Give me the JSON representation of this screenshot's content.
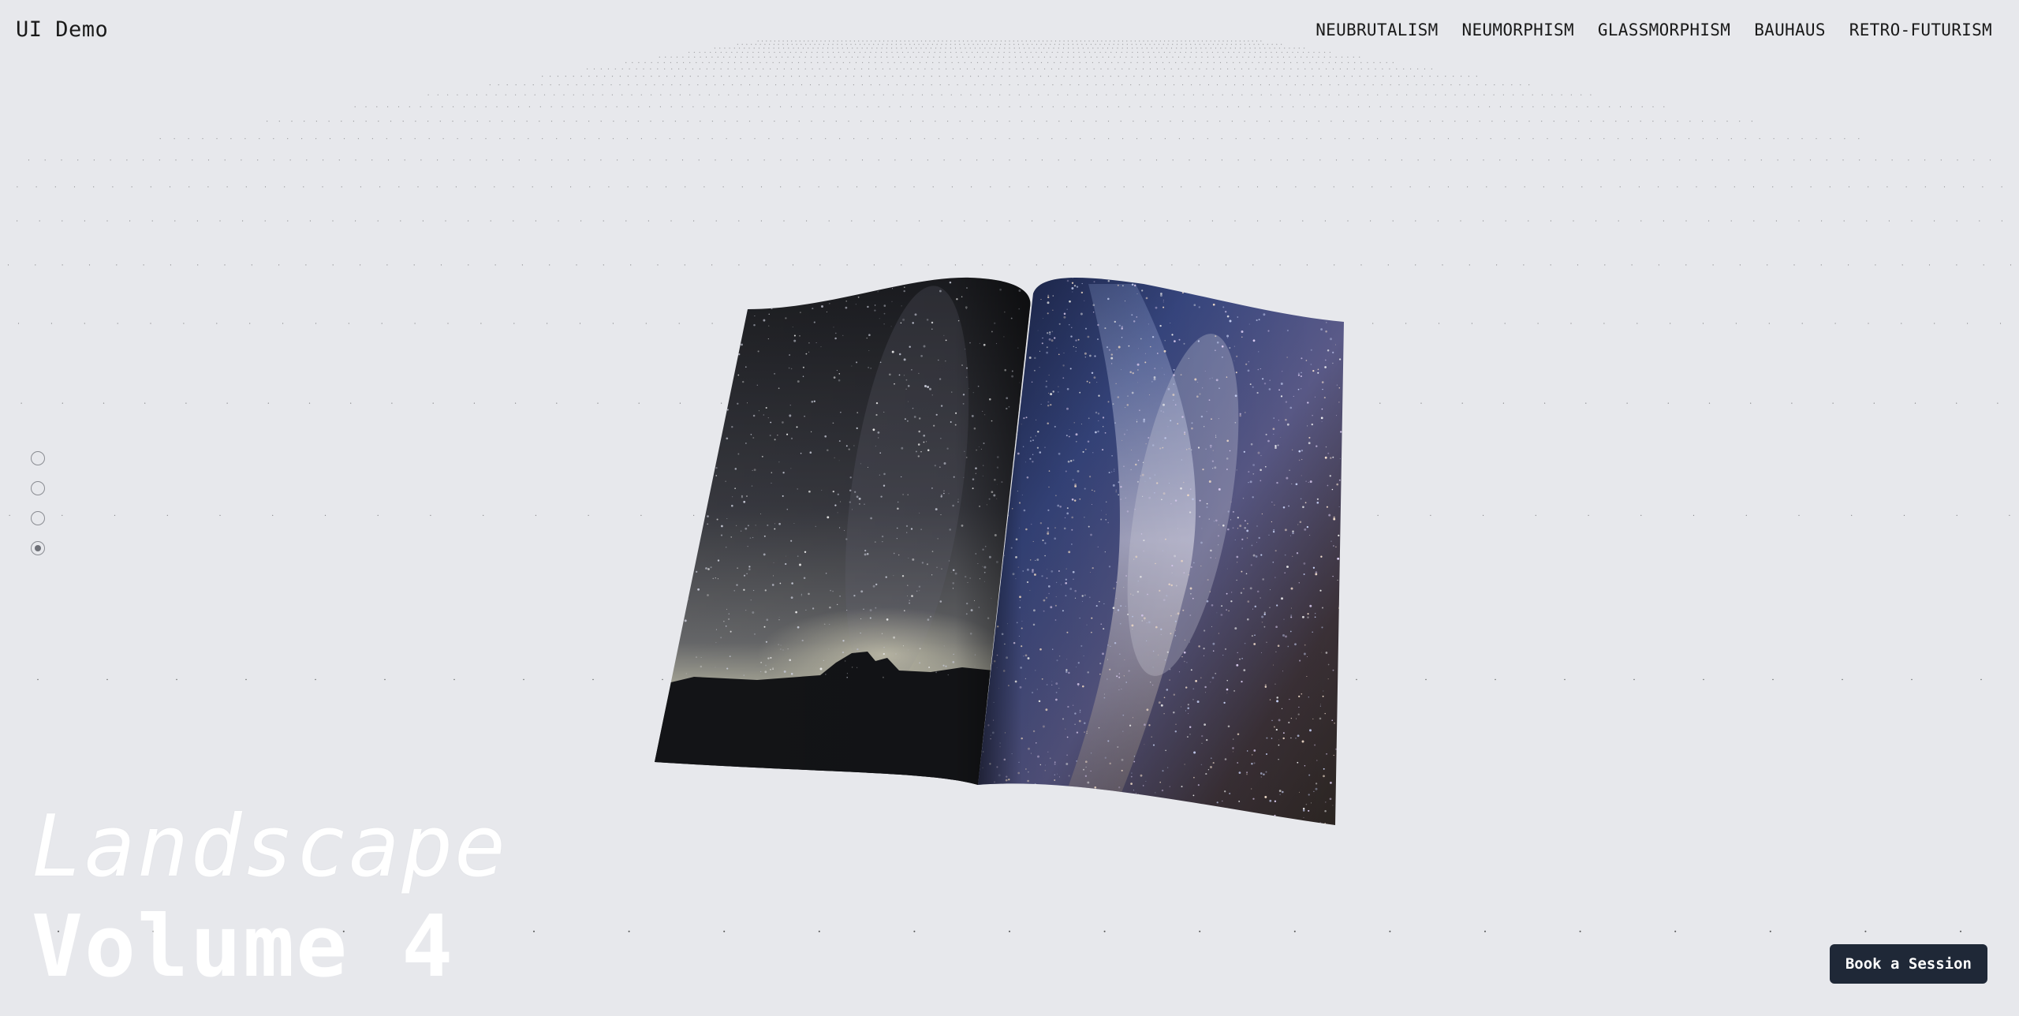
{
  "brand": "UI Demo",
  "nav": {
    "items": [
      {
        "label": "NEUBRUTALISM"
      },
      {
        "label": "NEUMORPHISM"
      },
      {
        "label": "GLASSMORPHISM"
      },
      {
        "label": "BAUHAUS"
      },
      {
        "label": "RETRO-FUTURISM"
      }
    ]
  },
  "pager": {
    "count": 4,
    "active_index": 3
  },
  "hero": {
    "line1": "Landscape",
    "line2": "Volume 4"
  },
  "cta": {
    "label": "Book a Session"
  },
  "colors": {
    "background": "#e7e8ec",
    "dot": "#111111",
    "cta_bg": "#1f2837",
    "title": "#ffffff"
  }
}
